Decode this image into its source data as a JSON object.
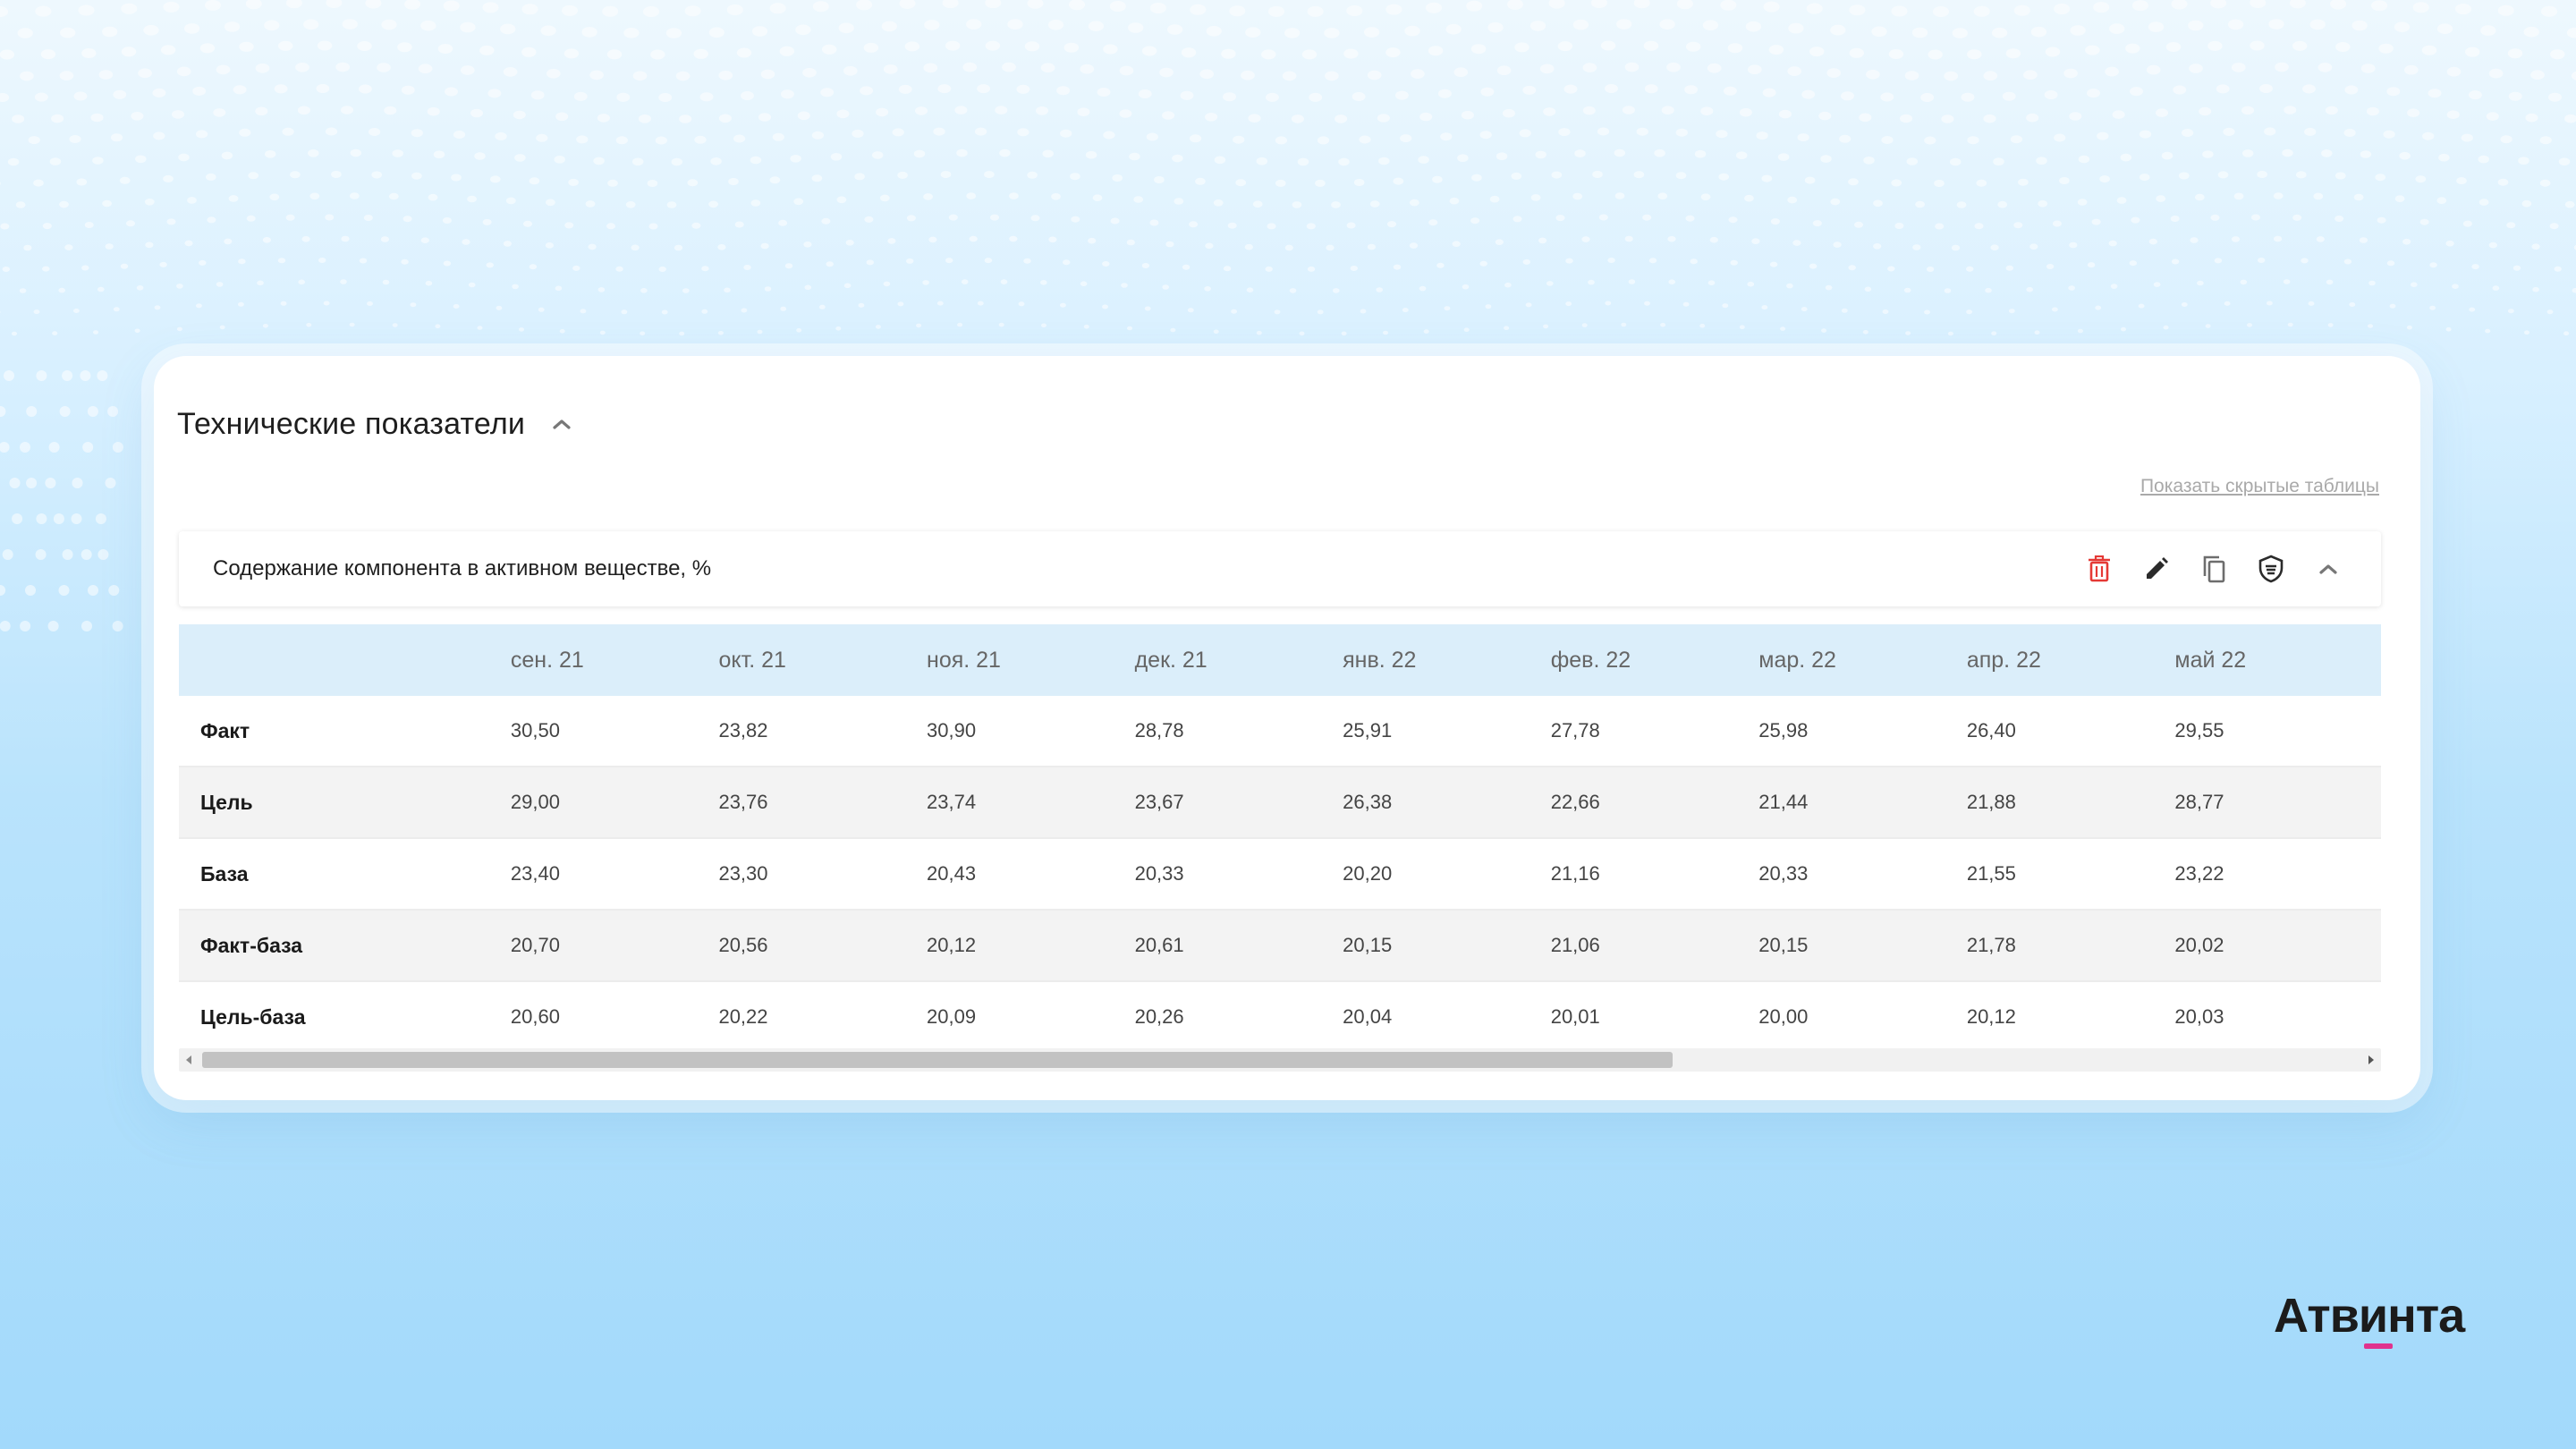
{
  "section": {
    "title": "Технические показатели",
    "show_hidden_link": "Показать скрытые таблицы"
  },
  "table_card": {
    "title": "Содержание компонента в активном веществе, %",
    "actions": [
      "trash-icon",
      "pencil-icon",
      "copy-icon",
      "shield-icon",
      "chevron-up-icon"
    ]
  },
  "table": {
    "months": [
      "сен. 21",
      "окт. 21",
      "ноя. 21",
      "дек. 21",
      "янв. 22",
      "фев. 22",
      "мар. 22",
      "апр. 22",
      "май 22"
    ],
    "rows": [
      {
        "label": "Факт",
        "values": [
          "30,50",
          "23,82",
          "30,90",
          "28,78",
          "25,91",
          "27,78",
          "25,98",
          "26,40",
          "29,55"
        ]
      },
      {
        "label": "Цель",
        "values": [
          "29,00",
          "23,76",
          "23,74",
          "23,67",
          "26,38",
          "22,66",
          "21,44",
          "21,88",
          "28,77"
        ]
      },
      {
        "label": "База",
        "values": [
          "23,40",
          "23,30",
          "20,43",
          "20,33",
          "20,20",
          "21,16",
          "20,33",
          "21,55",
          "23,22"
        ]
      },
      {
        "label": "Факт-база",
        "values": [
          "20,70",
          "20,56",
          "20,12",
          "20,61",
          "20,15",
          "21,06",
          "20,15",
          "21,78",
          "20,02"
        ]
      },
      {
        "label": "Цель-база",
        "values": [
          "20,60",
          "20,22",
          "20,09",
          "20,26",
          "20,04",
          "20,01",
          "20,00",
          "20,12",
          "20,03"
        ]
      }
    ]
  },
  "scrollbar": {
    "position": 0,
    "visible_fraction": 0.67
  },
  "brand": {
    "logo": "Атвинта",
    "accent_color": "#e0328d"
  },
  "colors": {
    "delete": "#e53935",
    "header_bg": "#dbeefa"
  }
}
